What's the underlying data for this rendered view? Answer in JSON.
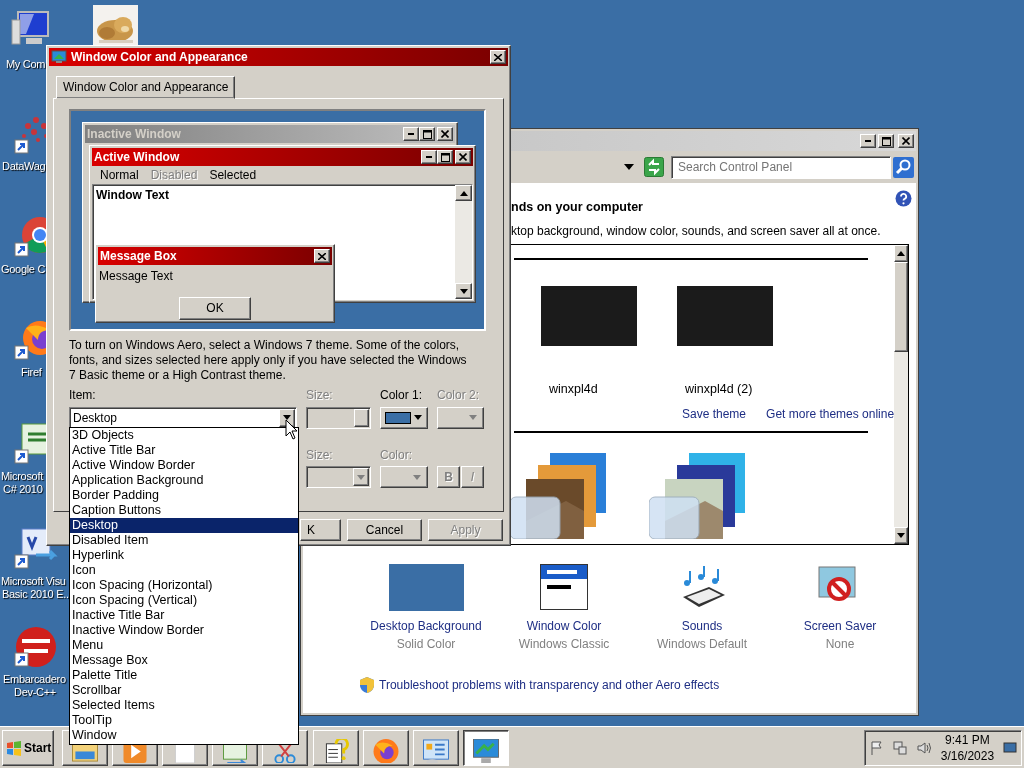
{
  "desktop_icons": [
    {
      "label": [
        "My Com"
      ]
    },
    {
      "label": [
        "DataWag"
      ]
    },
    {
      "label": [
        "Google C"
      ]
    },
    {
      "label": [
        "Firef"
      ]
    },
    {
      "label": [
        "Microsoft",
        "C# 2010"
      ]
    },
    {
      "label": [
        "Microsoft Visu",
        "Basic 2010 E.."
      ]
    },
    {
      "label": [
        "Embarcadero",
        "Dev-C++"
      ]
    }
  ],
  "control_panel": {
    "search_placeholder": "Search Control Panel",
    "heading": "nds on your computer",
    "description": "ktop background, window color, sounds, and screen saver all at once.",
    "themes": [
      {
        "label": "winxpl4d"
      },
      {
        "label": "winxpl4d (2)"
      }
    ],
    "links": [
      "Save theme",
      "Get more themes online"
    ],
    "settings": [
      {
        "title": "Desktop Background",
        "value": "Solid Color"
      },
      {
        "title": "Window Color",
        "value": "Windows Classic"
      },
      {
        "title": "Sounds",
        "value": "Windows Default"
      },
      {
        "title": "Screen Saver",
        "value": "None"
      }
    ],
    "troubleshoot": "Troubleshoot problems with transparency and other Aero effects"
  },
  "dialog": {
    "title": "Window Color and Appearance",
    "tabs": [
      {
        "label": "Window Color and Appearance",
        "selected": true
      }
    ],
    "preview": {
      "inactive_title": "Inactive Window",
      "active_title": "Active Window",
      "menu": [
        {
          "label": "Normal",
          "disabled": false
        },
        {
          "label": "Disabled",
          "disabled": true
        },
        {
          "label": "Selected",
          "disabled": false
        }
      ],
      "window_text": "Window Text",
      "message_title": "Message Box",
      "message_text": "Message Text",
      "ok_button": "OK"
    },
    "description": "To turn on Windows Aero, select a Windows 7 theme.  Some of the colors, fonts, and sizes selected here apply only if you have selected the Windows 7 Basic theme or a High Contrast theme.",
    "item_label": "Item:",
    "item_value": "Desktop",
    "size_label": {
      "text": "Size:",
      "disabled": true
    },
    "color1": {
      "label": "Color 1:",
      "disabled": false,
      "color": "#3a6ea5"
    },
    "color2": {
      "label": "Color 2:",
      "disabled": true
    },
    "font_size_label": {
      "text": "Size:",
      "disabled": true
    },
    "font_color_label": {
      "text": "Color:",
      "disabled": true
    },
    "bold_button": {
      "label": "B",
      "disabled": true
    },
    "italic_button": {
      "label": "I",
      "disabled": true
    },
    "buttons": [
      {
        "label": "K",
        "disabled": false
      },
      {
        "label": "Cancel",
        "disabled": false
      },
      {
        "label": "Apply",
        "disabled": true
      }
    ],
    "item_options": [
      {
        "label": "3D Objects",
        "selected": false
      },
      {
        "label": "Active Title Bar",
        "selected": false
      },
      {
        "label": "Active Window Border",
        "selected": false
      },
      {
        "label": "Application Background",
        "selected": false
      },
      {
        "label": "Border Padding",
        "selected": false
      },
      {
        "label": "Caption Buttons",
        "selected": false
      },
      {
        "label": "Desktop",
        "selected": true
      },
      {
        "label": "Disabled Item",
        "selected": false
      },
      {
        "label": "Hyperlink",
        "selected": false
      },
      {
        "label": "Icon",
        "selected": false
      },
      {
        "label": "Icon Spacing (Horizontal)",
        "selected": false
      },
      {
        "label": "Icon Spacing (Vertical)",
        "selected": false
      },
      {
        "label": "Inactive Title Bar",
        "selected": false
      },
      {
        "label": "Inactive Window Border",
        "selected": false
      },
      {
        "label": "Menu",
        "selected": false
      },
      {
        "label": "Message Box",
        "selected": false
      },
      {
        "label": "Palette Title",
        "selected": false
      },
      {
        "label": "Scrollbar",
        "selected": false
      },
      {
        "label": "Selected Items",
        "selected": false
      },
      {
        "label": "ToolTip",
        "selected": false
      },
      {
        "label": "Window",
        "selected": false
      }
    ]
  },
  "taskbar": {
    "start": "Start",
    "time": "9:41 PM",
    "date": "3/16/2023",
    "buttons": [
      {
        "selected": false
      },
      {
        "selected": false
      },
      {
        "selected": false
      },
      {
        "selected": false
      },
      {
        "selected": false
      },
      {
        "selected": false
      },
      {
        "selected": false
      },
      {
        "selected": false
      },
      {
        "selected": true
      }
    ]
  }
}
